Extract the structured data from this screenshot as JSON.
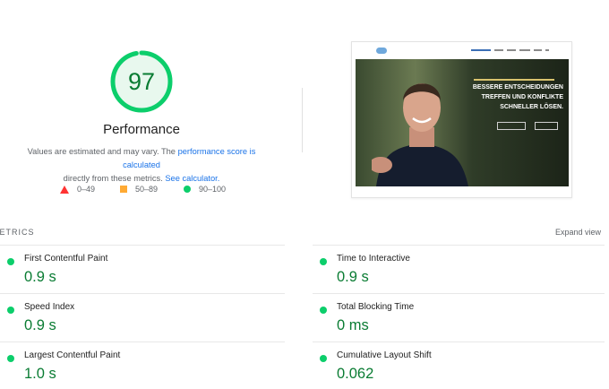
{
  "summary": {
    "score": "97",
    "title": "Performance",
    "desc_part1": "Values are estimated and may vary. The ",
    "desc_link1": "performance score is calculated",
    "desc_part2": "directly from these metrics. ",
    "desc_link2": "See calculator."
  },
  "legend": {
    "fail": "0–49",
    "average": "50–89",
    "pass": "90–100"
  },
  "colors": {
    "pass": "#0cce6b",
    "pass_text": "#0a7c33",
    "average": "#ffaa33",
    "fail": "#ff3333",
    "link": "#1a73e8"
  },
  "screenshot": {
    "hero_line1": "BESSERE ENTSCHEIDUNGEN",
    "hero_line2": "TREFFEN UND KONFLIKTE",
    "hero_line3": "SCHNELLER LÖSEN."
  },
  "metrics": {
    "header": "METRICS",
    "expand_label": "Expand view",
    "items": [
      {
        "label": "First Contentful Paint",
        "value": "0.9 s"
      },
      {
        "label": "Time to Interactive",
        "value": "0.9 s"
      },
      {
        "label": "Speed Index",
        "value": "0.9 s"
      },
      {
        "label": "Total Blocking Time",
        "value": "0 ms"
      },
      {
        "label": "Largest Contentful Paint",
        "value": "1.0 s"
      },
      {
        "label": "Cumulative Layout Shift",
        "value": "0.062"
      }
    ]
  }
}
